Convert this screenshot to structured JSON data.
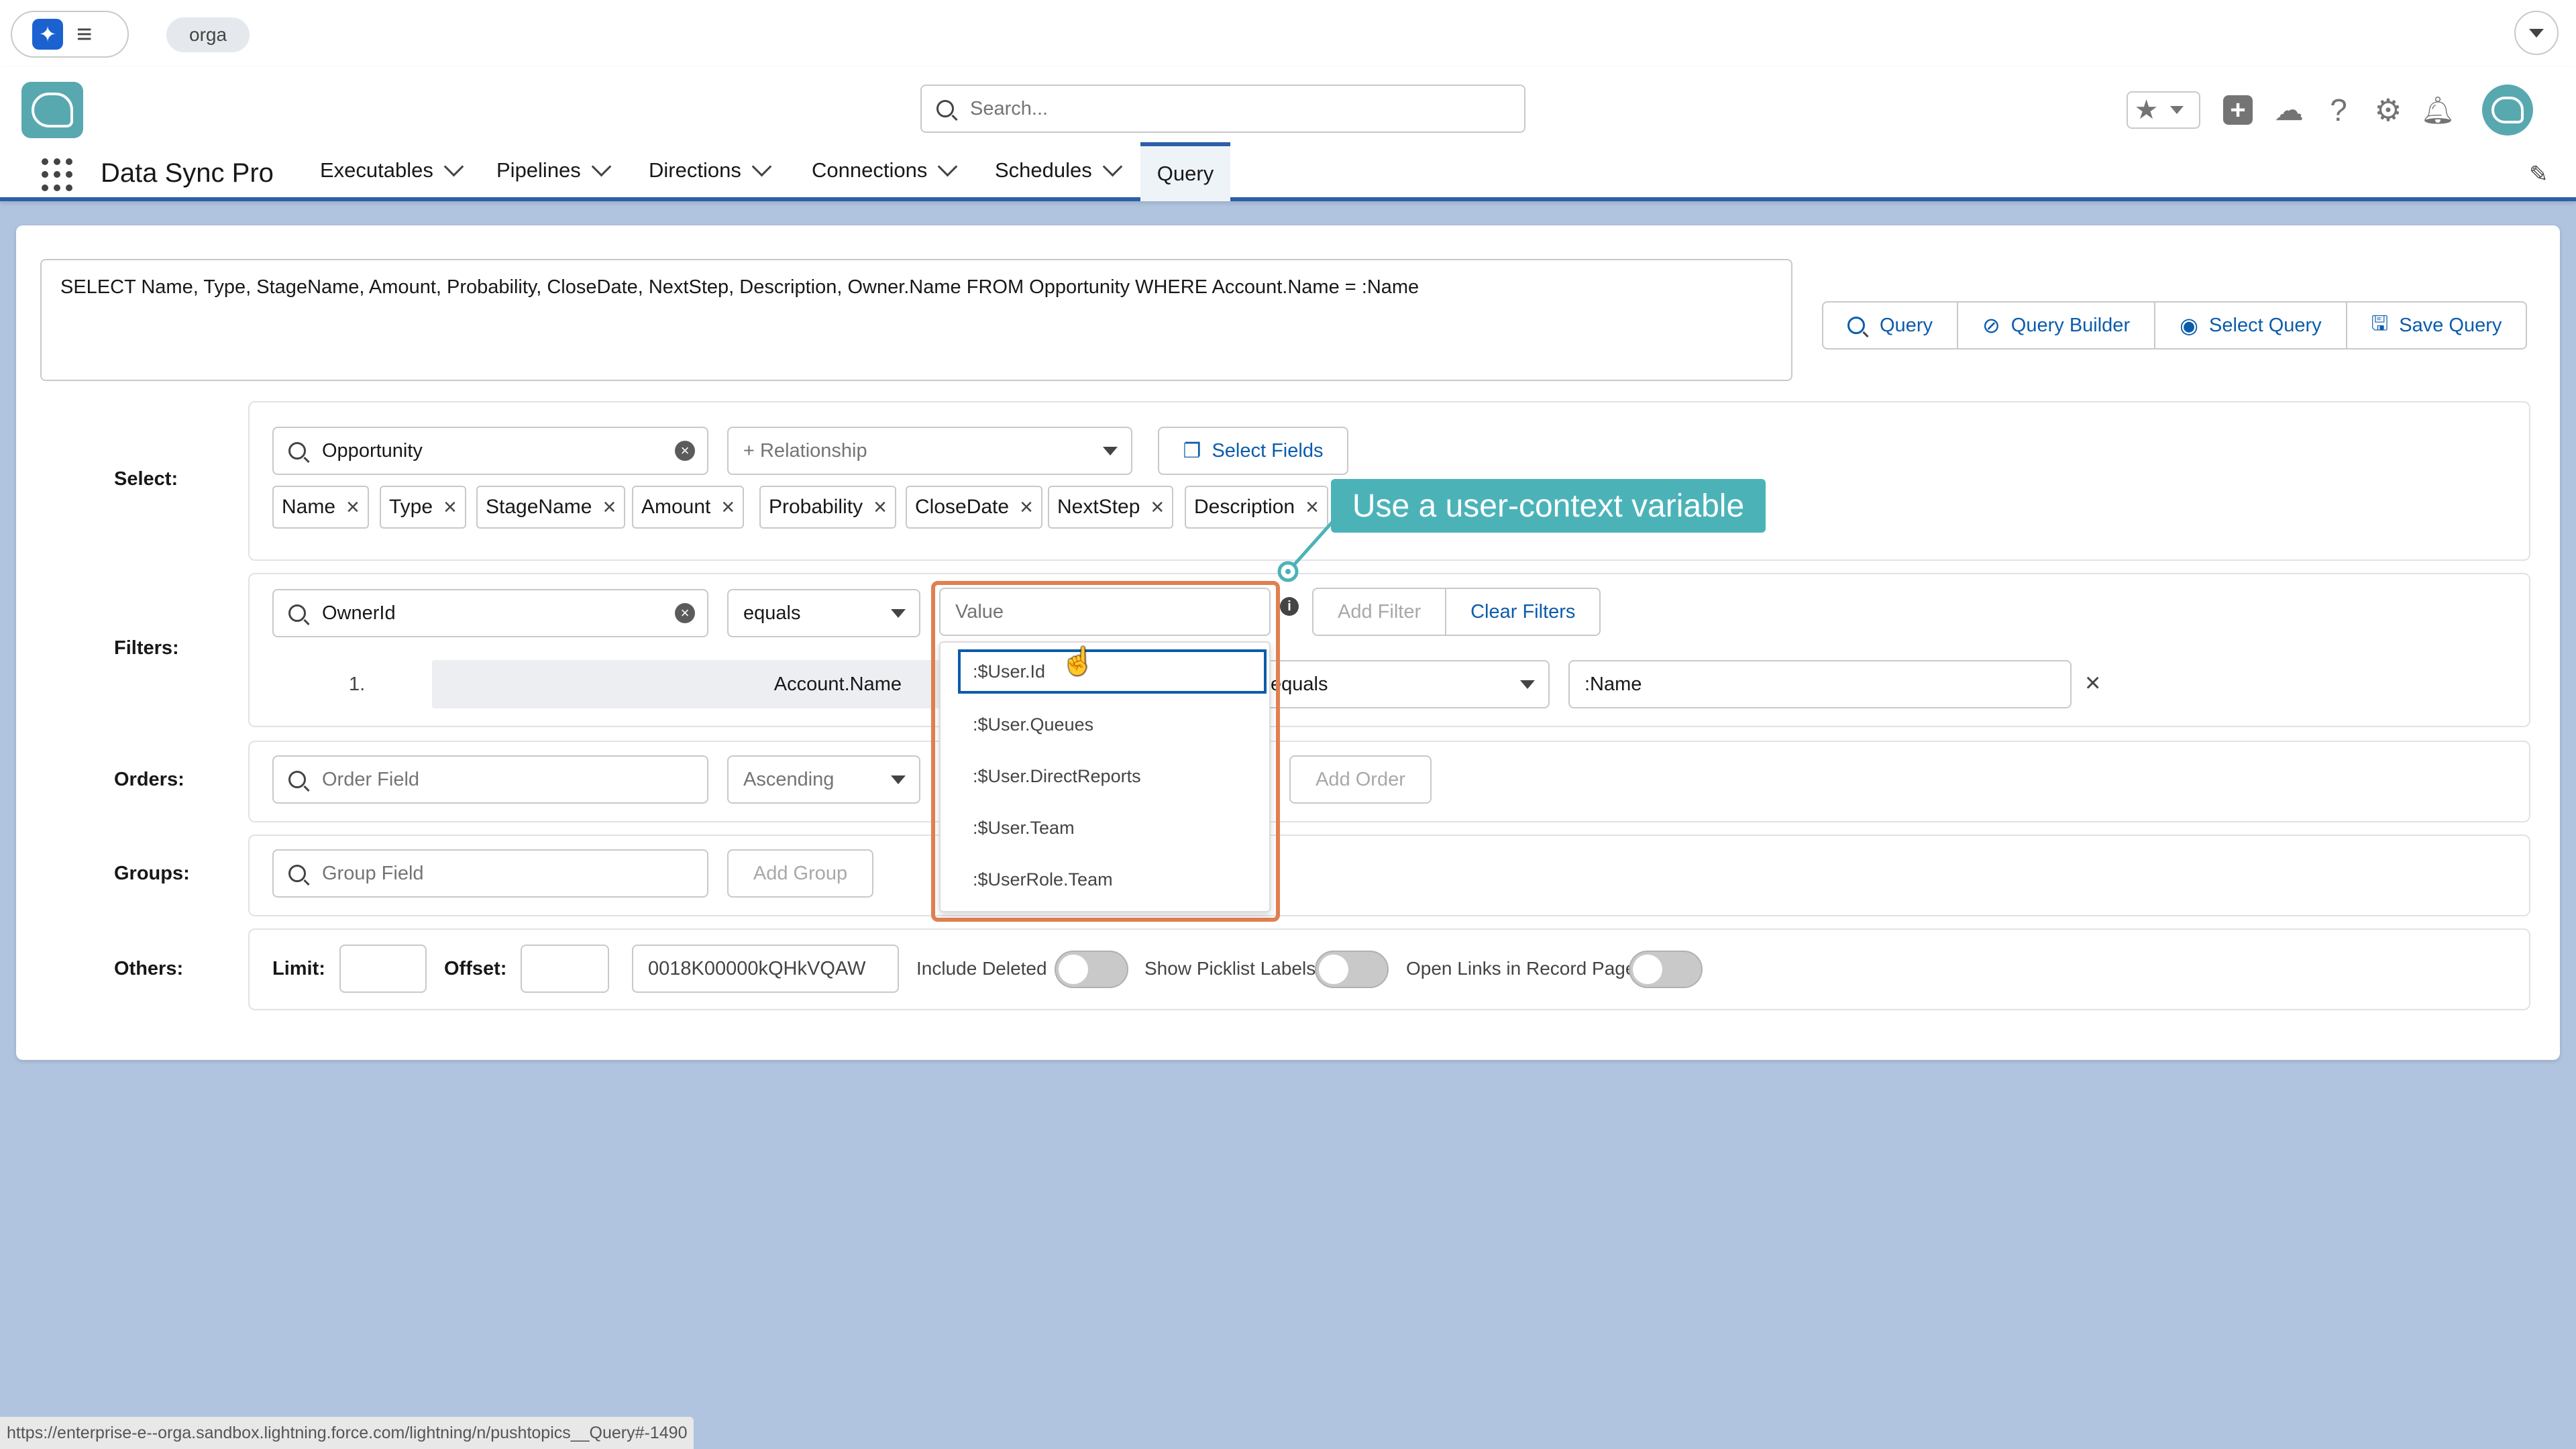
{
  "org_pill": "orga",
  "search": {
    "placeholder": "Search..."
  },
  "app": {
    "name": "Data Sync Pro"
  },
  "nav": [
    {
      "label": "Executables"
    },
    {
      "label": "Pipelines"
    },
    {
      "label": "Directions"
    },
    {
      "label": "Connections"
    },
    {
      "label": "Schedules"
    },
    {
      "label": "Query"
    }
  ],
  "query_text": "SELECT Name, Type, StageName, Amount, Probability, CloseDate, NextStep, Description, Owner.Name FROM Opportunity WHERE Account.Name = :Name",
  "query_buttons": {
    "query": "Query",
    "query_builder": "Query Builder",
    "select_query": "Select Query",
    "save_query": "Save Query"
  },
  "labels": {
    "select": "Select:",
    "filters": "Filters:",
    "orders": "Orders:",
    "groups": "Groups:",
    "others": "Others:"
  },
  "select_row": {
    "object": "Opportunity",
    "relationship_placeholder": "+ Relationship",
    "select_fields": "Select Fields",
    "fields": [
      "Name",
      "Type",
      "StageName",
      "Amount",
      "Probability",
      "CloseDate",
      "NextStep",
      "Description"
    ]
  },
  "tooltip": "Use a user-context variable",
  "filter_row": {
    "field": "OwnerId",
    "operator": "equals",
    "value_placeholder": "Value",
    "add_filter": "Add Filter",
    "clear_filters": "Clear Filters",
    "existing": {
      "index": "1.",
      "field": "Account.Name",
      "operator": "equals",
      "value": ":Name"
    }
  },
  "value_options": [
    ":$User.Id",
    ":$User.Queues",
    ":$User.DirectReports",
    ":$User.Team",
    ":$UserRole.Team"
  ],
  "order_row": {
    "field_placeholder": "Order Field",
    "direction": "Ascending",
    "add_order": "Add Order"
  },
  "group_row": {
    "field_placeholder": "Group Field",
    "add_group": "Add Group"
  },
  "others_row": {
    "limit_label": "Limit:",
    "offset_label": "Offset:",
    "record_id": "0018K00000kQHkVQAW",
    "include_deleted": "Include Deleted",
    "show_picklist_labels": "Show Picklist Labels",
    "open_links": "Open Links in Record Page"
  },
  "status_url": "https://enterprise-e--orga.sandbox.lightning.force.com/lightning/n/pushtopics__Query#-1490",
  "colors": {
    "brand_blue": "#0b5cab",
    "header_bar": "#2c5fa8",
    "highlight_orange": "#e0804f",
    "tooltip_teal": "#4bb3b8",
    "background": "#b0c4df"
  }
}
